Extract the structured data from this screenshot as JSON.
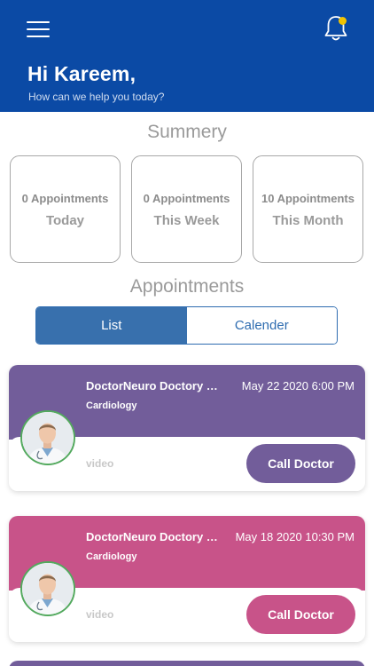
{
  "header": {
    "greeting": "Hi Kareem,",
    "subtitle": "How can we help you today?",
    "background": "#0b4aa5",
    "menu_icon": "hamburger-menu-icon",
    "bell_icon": "bell-icon",
    "notification_dot_color": "#f2c300"
  },
  "summary": {
    "title": "Summery",
    "cards": [
      {
        "count": "0 Appointments",
        "period": "Today"
      },
      {
        "count": "0 Appointments",
        "period": "This Week"
      },
      {
        "count": "10 Appointments",
        "period": "This Month"
      }
    ]
  },
  "appointments": {
    "title": "Appointments",
    "tabs": [
      {
        "label": "List",
        "selected": true
      },
      {
        "label": "Calender",
        "selected": false
      }
    ],
    "items": [
      {
        "doctor": "DoctorNeuro Doctory Neuro",
        "specialty": "Cardiology",
        "datetime": "May 22 2020 6:00 PM",
        "type": "video",
        "button": "Call Doctor",
        "color": "#725d9a"
      },
      {
        "doctor": "DoctorNeuro Doctory Neuro",
        "specialty": "Cardiology",
        "datetime": "May 18 2020 10:30 PM",
        "type": "video",
        "button": "Call Doctor",
        "color": "#c85389"
      }
    ],
    "next_card_color": "#725d9a"
  }
}
